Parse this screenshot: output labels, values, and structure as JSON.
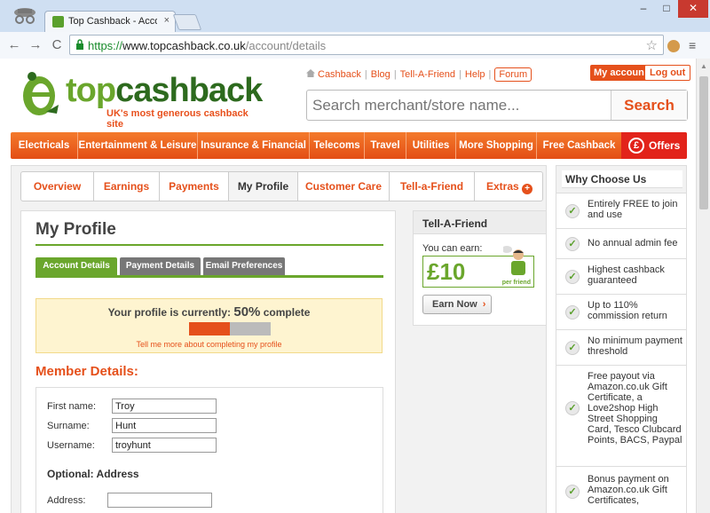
{
  "browser": {
    "tab_title": "Top Cashback - Account",
    "tab_close": "×",
    "url_scheme": "https://",
    "url_host": "www.topcashback.co.uk",
    "url_path": "/account/details",
    "win_min": "–",
    "win_max": "□",
    "win_close": "✕",
    "back": "←",
    "forward": "→",
    "reload": "C",
    "menu": "≡",
    "star": "☆"
  },
  "header": {
    "logo_top": "top",
    "logo_cash": "cashback",
    "tagline": "UK's most generous cashback site",
    "links": [
      "Cashback",
      "Blog",
      "Tell-A-Friend",
      "Help"
    ],
    "forum": "Forum",
    "my_account": "My account",
    "log_out": "Log out",
    "search_placeholder": "Search merchant/store name...",
    "search_button": "Search"
  },
  "categories": [
    "Electricals",
    "Entertainment & Leisure",
    "Insurance & Financial",
    "Telecoms",
    "Travel",
    "Utilities",
    "More Shopping",
    "Free Cashback"
  ],
  "offers": {
    "symbol": "£",
    "label": "Offers"
  },
  "account_tabs": [
    "Overview",
    "Earnings",
    "Payments",
    "My Profile",
    "Customer Care",
    "Tell-a-Friend",
    "Extras"
  ],
  "profile": {
    "title": "My Profile",
    "tabs": [
      "Account Details",
      "Payment Details",
      "Email Preferences"
    ],
    "completion_prefix": "Your profile is currently:",
    "completion_pct": "50%",
    "completion_suffix": "complete",
    "completion_fraction": 0.5,
    "completion_link": "Tell me more about completing my profile",
    "member_details_title": "Member Details:",
    "fields": [
      {
        "label": "First name:",
        "value": "Troy"
      },
      {
        "label": "Surname:",
        "value": "Hunt"
      },
      {
        "label": "Username:",
        "value": "troyhunt"
      }
    ],
    "optional_title": "Optional: Address",
    "address_label": "Address:",
    "address_value": ""
  },
  "tell_a_friend": {
    "title": "Tell-A-Friend",
    "earn_text": "You can earn:",
    "amount": "£10",
    "per_friend": "per friend",
    "button": "Earn Now",
    "arrow": "›"
  },
  "why": {
    "title": "Why Choose Us",
    "items": [
      "Entirely FREE to join and use",
      "No annual admin fee",
      "Highest cashback guaranteed",
      "Up to 110% commission return",
      "No minimum payment threshold",
      "Free payout via Amazon.co.uk Gift Certificate, a Love2shop High Street Shopping Card, Tesco Clubcard Points, BACS, Paypal",
      "Bonus payment on Amazon.co.uk Gift Certificates,"
    ]
  },
  "colors": {
    "brand_orange": "#e5501b",
    "brand_green": "#6aa62c",
    "offers_red": "#e2231a"
  }
}
